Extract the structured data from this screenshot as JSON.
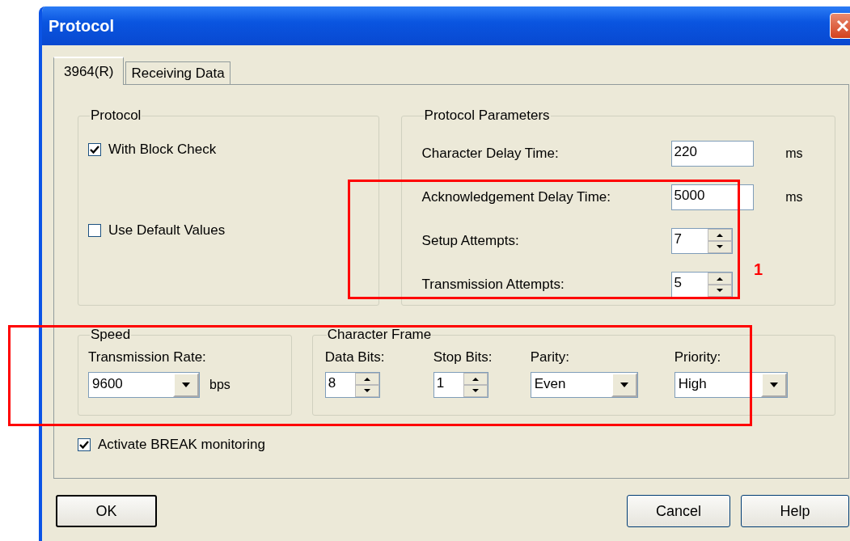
{
  "window": {
    "title": "Protocol"
  },
  "tabs": [
    {
      "label": "3964(R)",
      "selected": true
    },
    {
      "label": "Receiving Data",
      "selected": false
    }
  ],
  "protocol_group": {
    "title": "Protocol",
    "options": [
      {
        "label": "With Block Check",
        "checked": true
      },
      {
        "label": "Use Default Values",
        "checked": false
      }
    ]
  },
  "parameters": {
    "title": "Protocol Parameters",
    "rows": [
      {
        "kind": "text",
        "label": "Character Delay Time:",
        "value": "220",
        "unit": "ms"
      },
      {
        "kind": "text",
        "label": "Acknowledgement Delay Time:",
        "value": "5000",
        "unit": "ms"
      },
      {
        "kind": "spin",
        "label": "Setup Attempts:",
        "value": "7"
      },
      {
        "kind": "spin",
        "label": "Transmission Attempts:",
        "value": "5"
      }
    ]
  },
  "speed": {
    "title": "Speed",
    "label": "Transmission Rate:",
    "value": "9600",
    "unit": "bps"
  },
  "character_frame": {
    "title": "Character Frame",
    "fields": [
      {
        "kind": "spin",
        "label": "Data Bits:",
        "value": "8"
      },
      {
        "kind": "spin",
        "label": "Stop Bits:",
        "value": "1"
      },
      {
        "kind": "dropdown",
        "label": "Parity:",
        "value": "Even"
      },
      {
        "kind": "dropdown",
        "label": "Priority:",
        "value": "High"
      }
    ]
  },
  "break_monitoring": {
    "label": "Activate BREAK monitoring",
    "checked": true
  },
  "buttons": [
    {
      "label": "OK",
      "default": true
    },
    {
      "label": "Cancel",
      "default": false
    },
    {
      "label": "Help",
      "default": false
    }
  ],
  "annotations": [
    {
      "kind": "callout",
      "label": "1"
    },
    {
      "kind": "box"
    }
  ]
}
